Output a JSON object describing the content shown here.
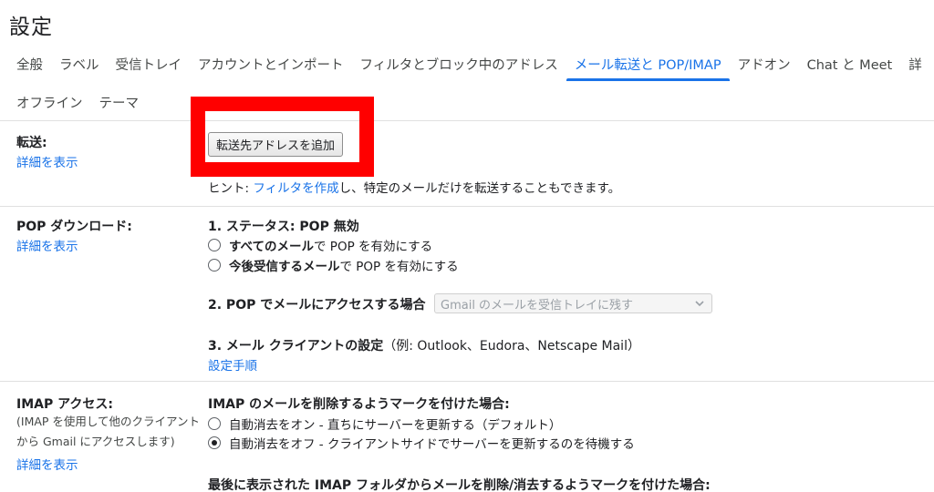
{
  "page": {
    "title": "設定"
  },
  "tabs": {
    "row1": [
      {
        "label": "全般",
        "active": false
      },
      {
        "label": "ラベル",
        "active": false
      },
      {
        "label": "受信トレイ",
        "active": false
      },
      {
        "label": "アカウントとインポート",
        "active": false
      },
      {
        "label": "フィルタとブロック中のアドレス",
        "active": false
      },
      {
        "label": "メール転送と POP/IMAP",
        "active": true
      },
      {
        "label": "アドオン",
        "active": false
      },
      {
        "label": "Chat と Meet",
        "active": false
      },
      {
        "label": "詳",
        "active": false
      }
    ],
    "row2": [
      {
        "label": "オフライン",
        "active": false
      },
      {
        "label": "テーマ",
        "active": false
      }
    ]
  },
  "forwarding": {
    "label": "転送:",
    "details_link": "詳細を表示",
    "add_button": "転送先アドレスを追加",
    "hint_prefix": "ヒント: ",
    "hint_link": "フィルタを作成",
    "hint_suffix": "し、特定のメールだけを転送することもできます。"
  },
  "pop": {
    "label": "POP ダウンロード:",
    "details_link": "詳細を表示",
    "status": "1. ステータス: POP 無効",
    "option1_bold": "すべてのメール",
    "option1_rest": "で POP を有効にする",
    "option2_bold": "今後受信するメール",
    "option2_rest": "で POP を有効にする",
    "access_label": "2. POP でメールにアクセスする場合",
    "access_select": "Gmail のメールを受信トレイに残す",
    "client_label": "3. メール クライアントの設定",
    "client_note": "（例: Outlook、Eudora、Netscape Mail）",
    "setup_link": "設定手順"
  },
  "imap": {
    "label": "IMAP アクセス:",
    "note": "(IMAP を使用して他のクライアントから Gmail にアクセスします)",
    "details_link": "詳細を表示",
    "heading1": "IMAP のメールを削除するようマークを付けた場合:",
    "option_on": "自動消去をオン - 直ちにサーバーを更新する（デフォルト）",
    "option_off": "自動消去をオフ - クライアントサイドでサーバーを更新するのを待機する",
    "heading2": "最後に表示された IMAP フォルダからメールを削除/消去するようマークを付けた場合:"
  },
  "colors": {
    "accent": "#1a73e8",
    "highlight": "#ff0000"
  }
}
